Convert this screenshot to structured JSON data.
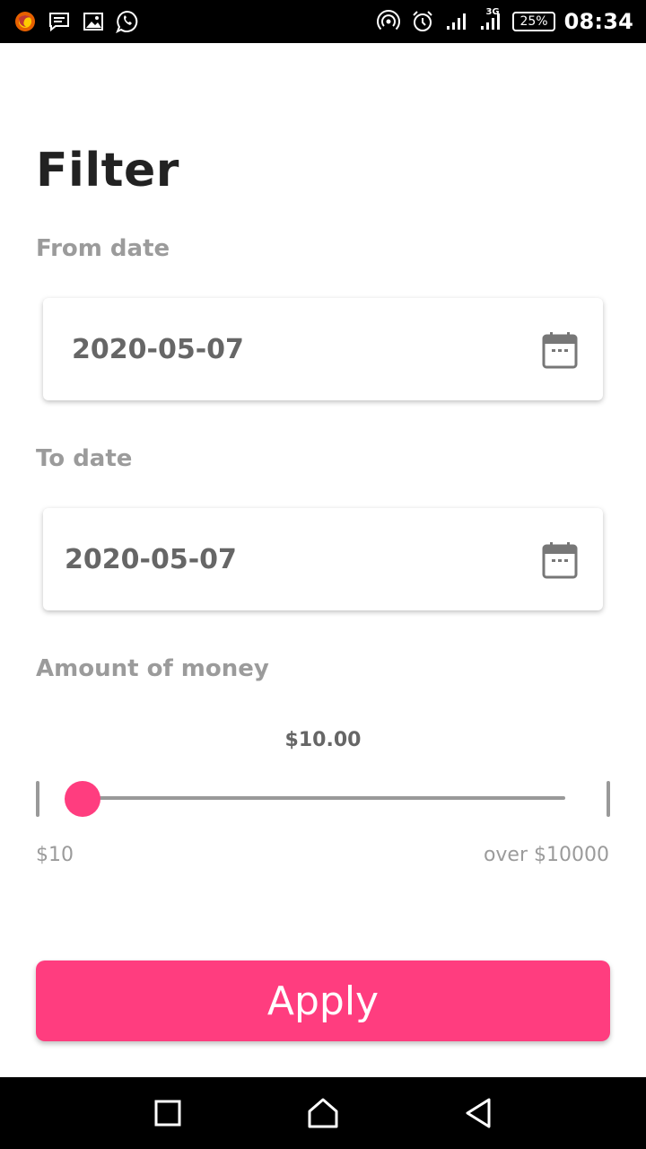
{
  "status_bar": {
    "icons": [
      "firefox-icon",
      "message-icon",
      "image-icon",
      "whatsapp-icon"
    ],
    "right_icons": [
      "hotspot-icon",
      "alarm-icon",
      "signal-icon",
      "signal-3g-icon"
    ],
    "network_tag": "3G",
    "battery": "25%",
    "time": "08:34"
  },
  "page": {
    "title": "Filter",
    "from_label": "From date",
    "from_value": "2020-05-07",
    "to_label": "To date",
    "to_value": "2020-05-07",
    "amount_label": "Amount of money",
    "amount_value": "$10.00",
    "amount_level": 0,
    "range_min": "$10",
    "range_max": "over $10000",
    "apply_label": "Apply"
  },
  "colors": {
    "accent": "#ff3d7f",
    "label_gray": "#9b9b9b",
    "value_gray": "#666666"
  },
  "nav_bar": {
    "buttons": [
      "recent-apps-icon",
      "home-icon",
      "back-icon"
    ]
  }
}
